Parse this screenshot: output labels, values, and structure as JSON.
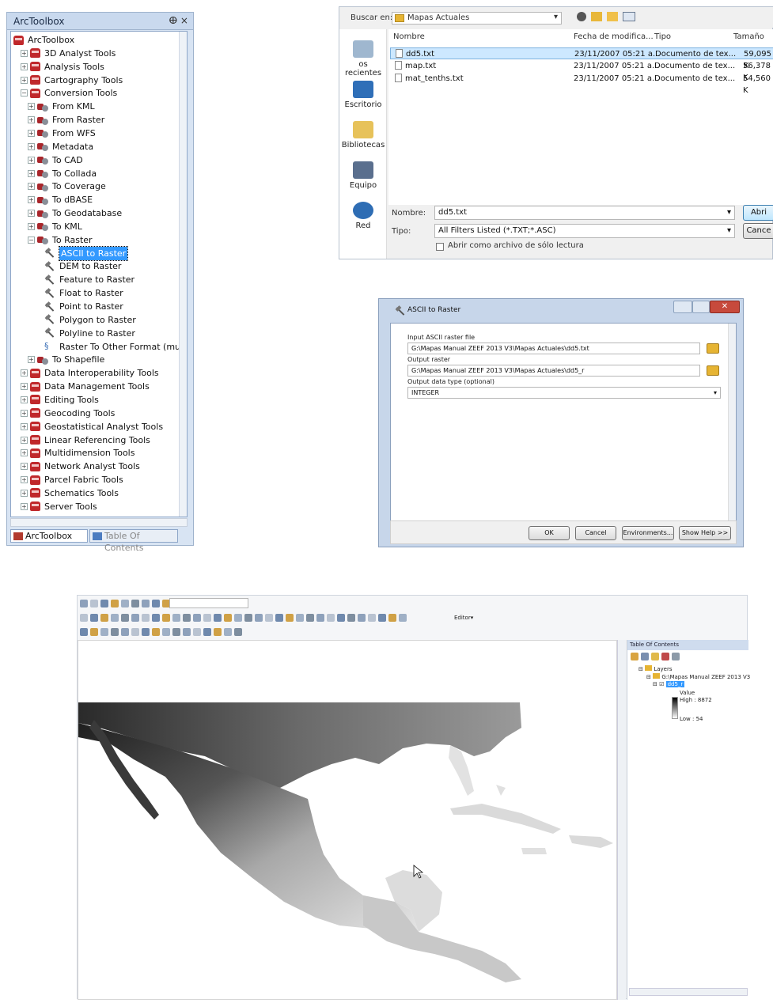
{
  "toolbox": {
    "title": "ArcToolbox",
    "pin": " ⴲ×",
    "root": "ArcToolbox",
    "top_items": [
      "3D Analyst Tools",
      "Analysis Tools",
      "Cartography Tools",
      "Conversion Tools"
    ],
    "conversion_items": [
      "From KML",
      "From Raster",
      "From WFS",
      "Metadata",
      "To CAD",
      "To Collada",
      "To Coverage",
      "To dBASE",
      "To Geodatabase",
      "To KML",
      "To Raster"
    ],
    "raster_tools": [
      "ASCII to Raster",
      "DEM to Raster",
      "Feature to Raster",
      "Float to Raster",
      "Point to Raster",
      "Polygon to Raster",
      "Polyline to Raster",
      "Raster To Other Format (mu"
    ],
    "after_items": [
      "To Shapefile"
    ],
    "bottom_items": [
      "Data Interoperability Tools",
      "Data Management Tools",
      "Editing Tools",
      "Geocoding Tools",
      "Geostatistical Analyst Tools",
      "Linear Referencing Tools",
      "Multidimension Tools",
      "Network Analyst Tools",
      "Parcel Fabric Tools",
      "Schematics Tools",
      "Server Tools"
    ],
    "tab_toolbox": "ArcToolbox",
    "tab_toc": "Table Of Contents"
  },
  "open_dialog": {
    "look_in_label": "Buscar en:",
    "look_in_value": "Mapas Actuales",
    "places": [
      "os recientes",
      "Escritorio",
      "Bibliotecas",
      "Equipo",
      "Red"
    ],
    "columns": [
      "Nombre",
      "Fecha de modifica...",
      "Tipo",
      "Tamaño"
    ],
    "files": [
      {
        "name": "dd5.txt",
        "date": "23/11/2007 05:21 a...",
        "type": "Documento de tex...",
        "size": "59,095 K"
      },
      {
        "name": "map.txt",
        "date": "23/11/2007 05:21 a...",
        "type": "Documento de tex...",
        "size": "56,378 K"
      },
      {
        "name": "mat_tenths.txt",
        "date": "23/11/2007 05:21 a...",
        "type": "Documento de tex...",
        "size": "54,560 K"
      }
    ],
    "name_label": "Nombre:",
    "name_value": "dd5.txt",
    "type_label": "Tipo:",
    "type_value": "All Filters Listed (*.TXT;*.ASC)",
    "readonly_label": "Abrir como archivo de sólo lectura",
    "open_btn": "Abri",
    "cancel_btn": "Cance"
  },
  "ascii_dialog": {
    "title": "ASCII to Raster",
    "input_label": "Input ASCII raster file",
    "input_value": "G:\\Mapas Manual ZEEF 2013 V3\\Mapas Actuales\\dd5.txt",
    "output_label": "Output raster",
    "output_value": "G:\\Mapas Manual ZEEF 2013 V3\\Mapas Actuales\\dd5_r",
    "type_label": "Output data type (optional)",
    "type_value": "INTEGER",
    "ok": "OK",
    "cancel": "Cancel",
    "env": "Environments...",
    "help": "Show Help >>"
  },
  "arcmap": {
    "editor": "Editor▾",
    "toc_title": "Table Of Contents",
    "layers": "Layers",
    "path": "G:\\Mapas Manual ZEEF 2013 V3",
    "layer": "dd5_r",
    "value": "Value",
    "high": "High : 8872",
    "low": "Low : 54"
  }
}
